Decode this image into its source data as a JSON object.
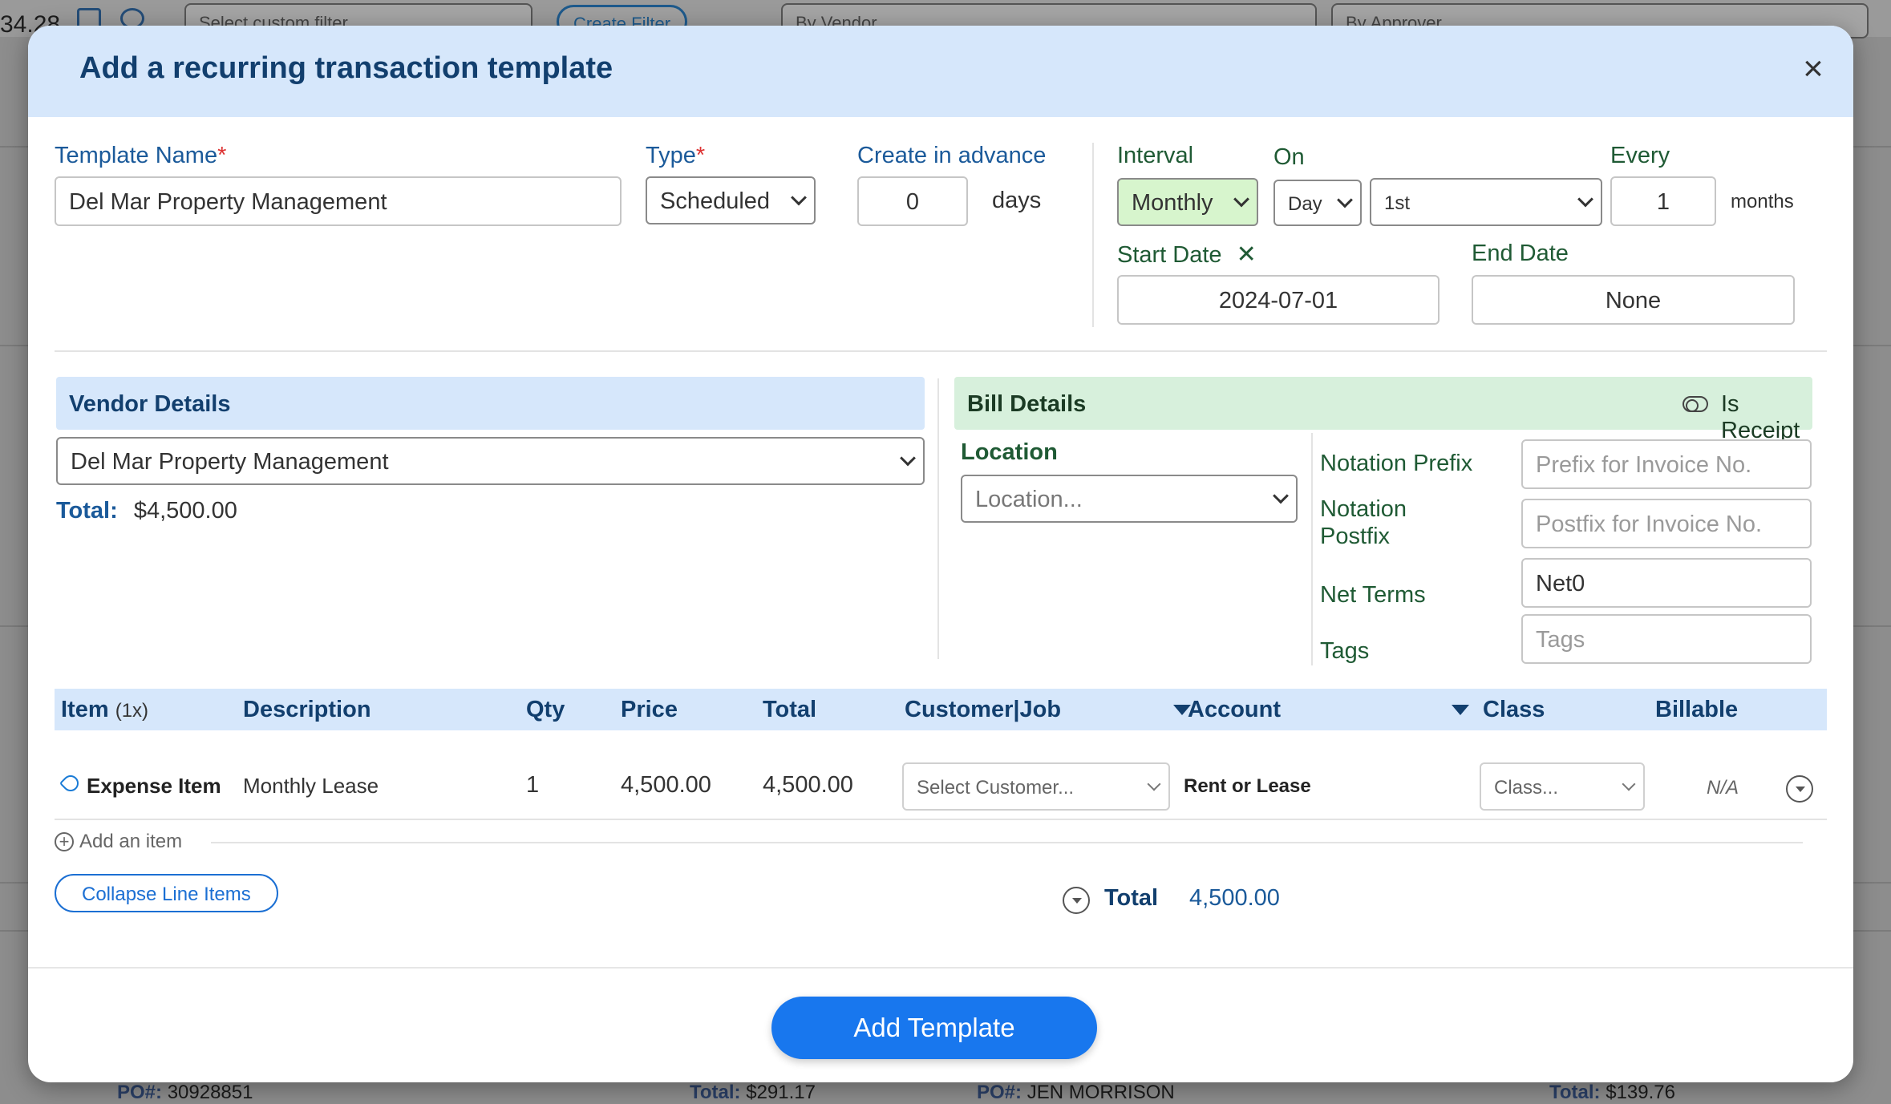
{
  "background": {
    "amount": "34.28",
    "filter_placeholder": "Select custom filter",
    "create_filter": "Create Filter",
    "by_vendor": "By Vendor",
    "by_approver": "By Approver",
    "bottom": {
      "po1_label": "PO#:",
      "po1_value": "30928851",
      "total1_label": "Total:",
      "total1_value": "$291.17",
      "po2_label": "PO#:",
      "po2_value": "JEN MORRISON",
      "total2_label": "Total:",
      "total2_value": "$139.76"
    }
  },
  "modal": {
    "title": "Add a recurring transaction template",
    "template_name": {
      "label": "Template Name",
      "value": "Del Mar Property Management"
    },
    "type": {
      "label": "Type",
      "value": "Scheduled"
    },
    "create_in_advance": {
      "label": "Create in advance",
      "value": "0",
      "unit": "days"
    },
    "interval": {
      "label": "Interval",
      "value": "Monthly"
    },
    "on": {
      "label": "On",
      "unit_value": "Day",
      "day_value": "1st"
    },
    "every": {
      "label": "Every",
      "value": "1",
      "unit": "months"
    },
    "start_date": {
      "label": "Start Date",
      "value": "2024-07-01"
    },
    "end_date": {
      "label": "End Date",
      "value": "None"
    },
    "vendor": {
      "header": "Vendor Details",
      "value": "Del Mar Property Management",
      "total_label": "Total:",
      "total_value": "$4,500.00"
    },
    "bill": {
      "header": "Bill Details",
      "is_receipt_label": "Is Receipt",
      "location_label": "Location",
      "location_placeholder": "Location...",
      "notation_prefix_label": "Notation Prefix",
      "notation_prefix_placeholder": "Prefix for Invoice No.",
      "notation_postfix_label_1": "Notation",
      "notation_postfix_label_2": "Postfix",
      "notation_postfix_placeholder": "Postfix for Invoice No.",
      "net_terms_label": "Net Terms",
      "net_terms_value": "Net0",
      "tags_label": "Tags",
      "tags_placeholder": "Tags"
    },
    "table": {
      "headers": {
        "item": "Item",
        "item_count": "(1x)",
        "description": "Description",
        "qty": "Qty",
        "price": "Price",
        "total": "Total",
        "customer_job": "Customer|Job",
        "account": "Account",
        "class": "Class",
        "billable": "Billable"
      },
      "rows": [
        {
          "item": "Expense Item",
          "description": "Monthly Lease",
          "qty": "1",
          "price": "4,500.00",
          "total": "4,500.00",
          "customer_placeholder": "Select Customer...",
          "account": "Rent or Lease",
          "class_placeholder": "Class...",
          "billable": "N/A"
        }
      ]
    },
    "add_item_label": "Add an item",
    "collapse_label": "Collapse Line Items",
    "grand_total_label": "Total",
    "grand_total_value": "4,500.00",
    "submit_label": "Add Template"
  }
}
